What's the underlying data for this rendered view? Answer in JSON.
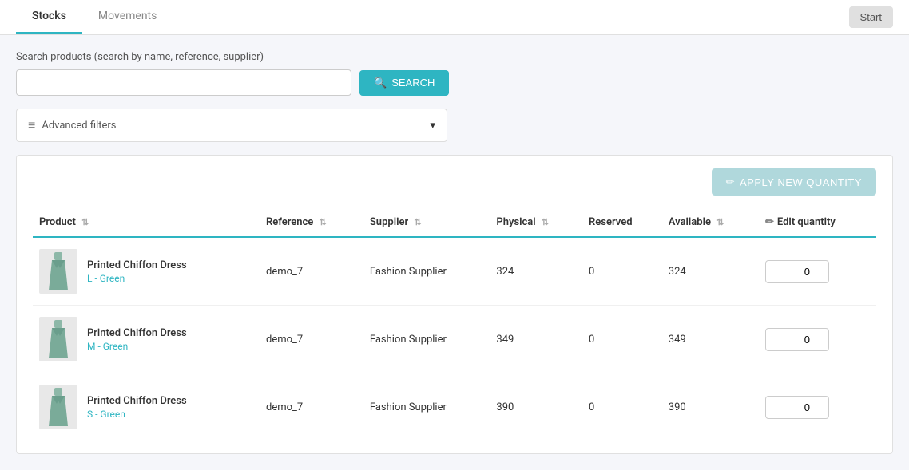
{
  "tabs": {
    "stocks": "Stocks",
    "movements": "Movements",
    "active_tab": "stocks",
    "start_button": "Start"
  },
  "search": {
    "label": "Search products (search by name, reference, supplier)",
    "placeholder": "",
    "button_label": "SEARCH"
  },
  "filters": {
    "label": "Advanced filters",
    "chevron": "▾"
  },
  "table": {
    "apply_button": "APPLY NEW QUANTITY",
    "columns": {
      "product": "Product",
      "reference": "Reference",
      "supplier": "Supplier",
      "physical": "Physical",
      "reserved": "Reserved",
      "available": "Available",
      "edit_quantity": "Edit quantity"
    },
    "rows": [
      {
        "product_name": "Printed Chiffon Dress",
        "variant": "L - Green",
        "reference": "demo_7",
        "supplier": "Fashion Supplier",
        "physical": "324",
        "reserved": "0",
        "available": "324",
        "edit_value": "0"
      },
      {
        "product_name": "Printed Chiffon Dress",
        "variant": "M - Green",
        "reference": "demo_7",
        "supplier": "Fashion Supplier",
        "physical": "349",
        "reserved": "0",
        "available": "349",
        "edit_value": "0"
      },
      {
        "product_name": "Printed Chiffon Dress",
        "variant": "S - Green",
        "reference": "demo_7",
        "supplier": "Fashion Supplier",
        "physical": "390",
        "reserved": "0",
        "available": "390",
        "edit_value": "0"
      }
    ]
  }
}
